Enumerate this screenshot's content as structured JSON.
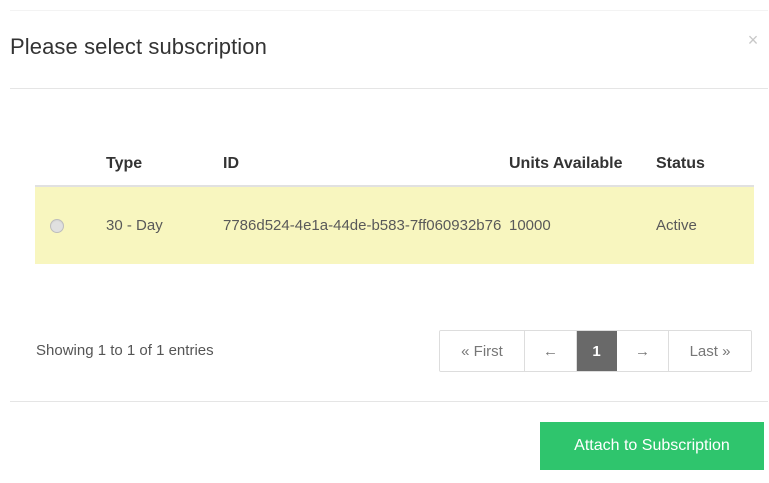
{
  "modal": {
    "title": "Please select subscription",
    "close_label": "×"
  },
  "table": {
    "headers": {
      "select": "",
      "type": "Type",
      "id": "ID",
      "units": "Units Available",
      "status": "Status"
    },
    "rows": [
      {
        "selected": false,
        "type": "30 - Day",
        "id": "7786d524-4e1a-44de-b583-7ff060932b76",
        "units": "10000",
        "status": "Active"
      }
    ]
  },
  "pagination": {
    "info": "Showing 1 to 1 of 1 entries",
    "first": "« First",
    "prev": "←",
    "current": "1",
    "next": "→",
    "last": "Last »"
  },
  "actions": {
    "attach": "Attach to Subscription"
  },
  "colors": {
    "accent": "#2fc56d",
    "row_highlight": "#f8f6bf",
    "pagination_active": "#696969"
  },
  "icons": {
    "close": "close-icon",
    "radio": "radio-button-icon"
  }
}
